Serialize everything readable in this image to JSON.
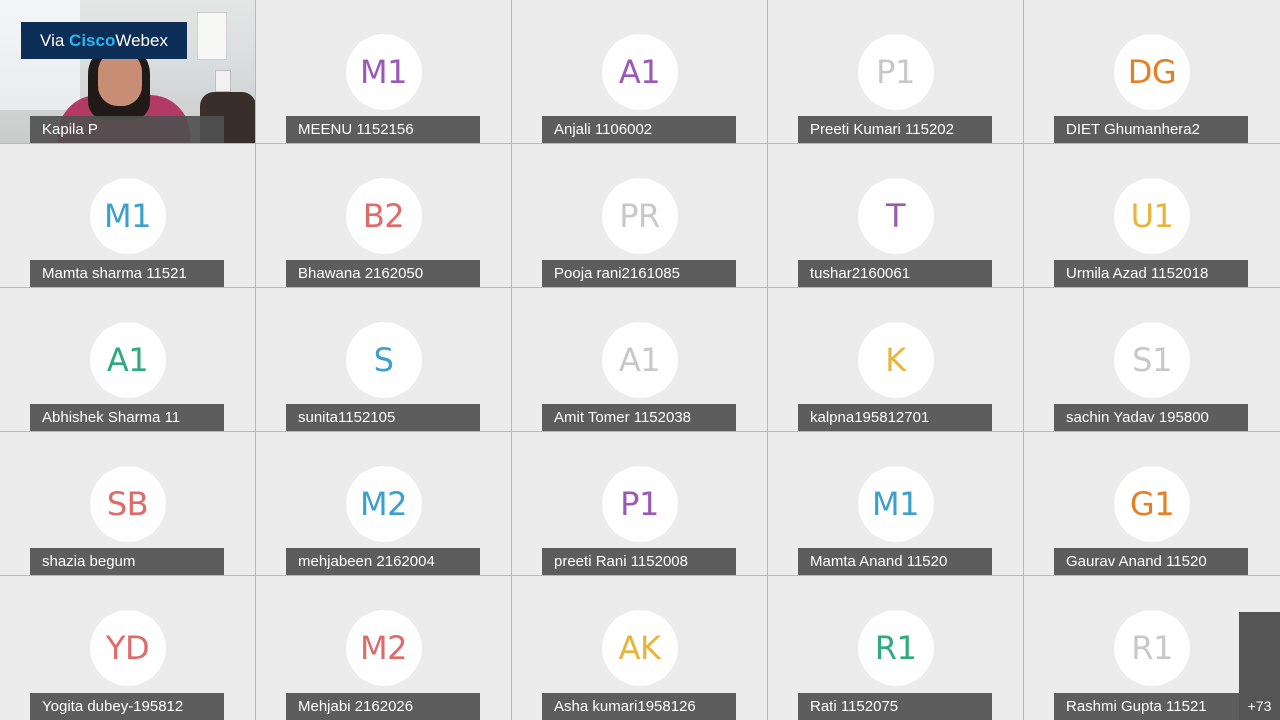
{
  "badge": {
    "via": "Via ",
    "cisco": "Cisco",
    "webex": "Webex"
  },
  "video_participant": {
    "name": "Kapila P"
  },
  "participants": [
    {
      "initials": "M1",
      "name": "MEENU 1152156",
      "color": "#9b59b6"
    },
    {
      "initials": "A1",
      "name": "Anjali 1106002",
      "color": "#9b59b6"
    },
    {
      "initials": "P1",
      "name": "Preeti Kumari 115202",
      "color": "#c8c8c8"
    },
    {
      "initials": "DG",
      "name": "DIET Ghumanhera2",
      "color": "#e67e22"
    },
    {
      "initials": "M1",
      "name": "Mamta sharma 11521",
      "color": "#3aa0d0"
    },
    {
      "initials": "B2",
      "name": "Bhawana 2162050",
      "color": "#e06a6a"
    },
    {
      "initials": "PR",
      "name": "Pooja rani2161085",
      "color": "#c8c8c8"
    },
    {
      "initials": "T",
      "name": "tushar2160061",
      "color": "#9b59b6"
    },
    {
      "initials": "U1",
      "name": "Urmila Azad 1152018",
      "color": "#e8b53a"
    },
    {
      "initials": "A1",
      "name": "Abhishek Sharma 11",
      "color": "#2eaa7c"
    },
    {
      "initials": "S",
      "name": "sunita1152105",
      "color": "#3aa0d0"
    },
    {
      "initials": "A1",
      "name": "Amit Tomer 1152038",
      "color": "#c8c8c8"
    },
    {
      "initials": "K",
      "name": "kalpna195812701",
      "color": "#e8b53a"
    },
    {
      "initials": "S1",
      "name": "sachin Yadav 195800",
      "color": "#c8c8c8"
    },
    {
      "initials": "SB",
      "name": "shazia begum",
      "color": "#e06a6a"
    },
    {
      "initials": "M2",
      "name": "mehjabeen 2162004",
      "color": "#3aa0d0"
    },
    {
      "initials": "P1",
      "name": "preeti Rani 1152008",
      "color": "#9b59b6"
    },
    {
      "initials": "M1",
      "name": "Mamta Anand 11520",
      "color": "#3aa0d0"
    },
    {
      "initials": "G1",
      "name": "Gaurav Anand 11520",
      "color": "#e67e22"
    },
    {
      "initials": "YD",
      "name": "Yogita dubey-195812",
      "color": "#e06a6a"
    },
    {
      "initials": "M2",
      "name": "Mehjabi 2162026",
      "color": "#e06a6a"
    },
    {
      "initials": "AK",
      "name": "Asha kumari1958126",
      "color": "#e8b53a"
    },
    {
      "initials": "R1",
      "name": "Rati 1152075",
      "color": "#2eaa7c"
    },
    {
      "initials": "R1",
      "name": "Rashmi Gupta 11521",
      "color": "#c8c8c8"
    }
  ],
  "overflow": {
    "label": "+73"
  }
}
